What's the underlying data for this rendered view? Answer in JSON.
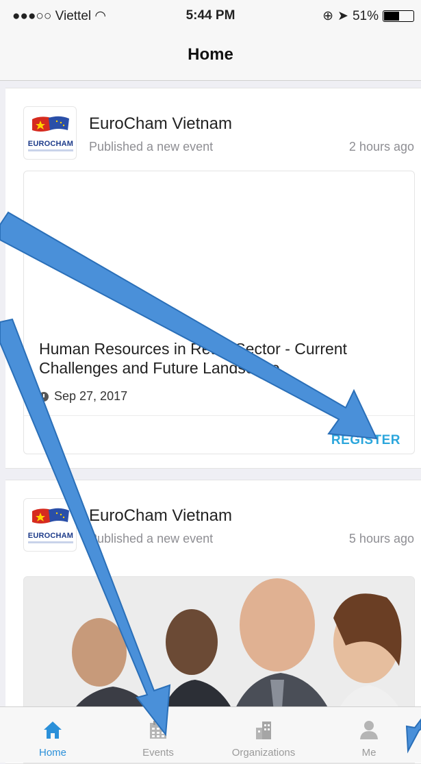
{
  "status_bar": {
    "carrier": "●●●○○ Viettel",
    "time": "5:44 PM",
    "battery": "51%",
    "battery_level": 0.51
  },
  "header": {
    "title": "Home"
  },
  "feed": [
    {
      "org_name": "EuroCham Vietnam",
      "action": "Published a new event",
      "time_ago": "2 hours ago",
      "event_title": "Human Resources in Retail Sector - Current Challenges and Future Landscape",
      "event_date": "Sep 27, 2017",
      "register_label": "REGISTER"
    },
    {
      "org_name": "EuroCham Vietnam",
      "action": "Published a new event",
      "time_ago": "5 hours ago"
    }
  ],
  "logo": {
    "brand": "EUROCHAM"
  },
  "tabs": [
    {
      "label": "Home",
      "icon": "home-icon",
      "active": true
    },
    {
      "label": "Events",
      "icon": "calendar-icon",
      "active": false
    },
    {
      "label": "Organizations",
      "icon": "buildings-icon",
      "active": false
    },
    {
      "label": "Me",
      "icon": "person-icon",
      "active": false
    }
  ],
  "colors": {
    "accent": "#2ba6dc",
    "tab_active": "#2b90d9",
    "annotation_arrow": "#4a90d9"
  }
}
